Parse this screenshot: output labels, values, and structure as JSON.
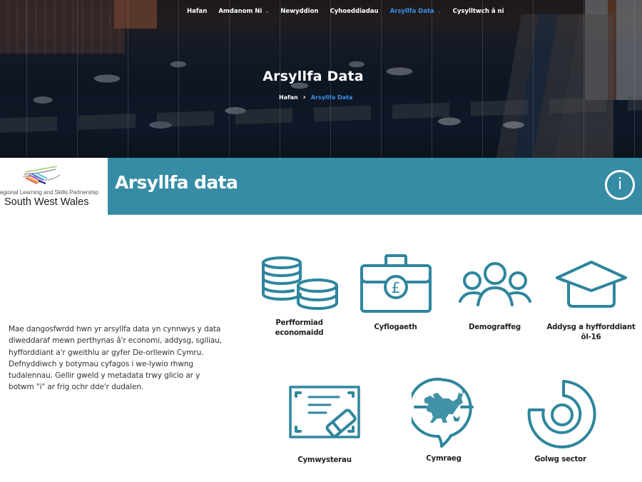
{
  "nav": {
    "items": [
      {
        "label": "Hafan",
        "dropdown": false,
        "active": false
      },
      {
        "label": "Amdanom Ni",
        "dropdown": true,
        "active": false
      },
      {
        "label": "Newyddion",
        "dropdown": false,
        "active": false
      },
      {
        "label": "Cyhoeddiadau",
        "dropdown": false,
        "active": false
      },
      {
        "label": "Arsyllfa Data",
        "dropdown": true,
        "active": true
      },
      {
        "label": "Cysylltwch â ni",
        "dropdown": false,
        "active": false
      }
    ],
    "chevron": "⌄"
  },
  "hero": {
    "title": "Arsyllfa Data",
    "breadcrumb": {
      "home": "Hafan",
      "separator": "›",
      "current": "Arsyllfa Data"
    }
  },
  "banner": {
    "logo_subtitle": "Regional Learning and Skills Partnership",
    "logo_title": "South West Wales",
    "title": "Arsyllfa data",
    "info_label": "i"
  },
  "description": "Mae dangosfwrdd hwn yr arsyllfa data yn cynnwys y data diweddaraf mewn perthynas â'r economi, addysg, sgiliau, hyfforddiant a'r gweithlu ar gyfer De-orllewin Cymru. Defnyddiwch y botymau cyfagos i we-lywio rhwng tudalennau. Gellir gweld y metadata trwy glicio ar y botwm \"i\" ar frig ochr dde'r dudalen.",
  "tiles": [
    {
      "label": "Perfformiad economaidd",
      "icon": "coins-icon"
    },
    {
      "label": "Cyflogaeth",
      "icon": "briefcase-pound-icon"
    },
    {
      "label": "Demograffeg",
      "icon": "people-icon"
    },
    {
      "label": "Addysg a hyfforddiant ôl-16",
      "icon": "graduation-cap-icon"
    },
    {
      "label": "Cymwysterau",
      "icon": "certificate-icon"
    },
    {
      "label": "Cymraeg",
      "icon": "welsh-dragon-speech-icon"
    },
    {
      "label": "Golwg sector",
      "icon": "sector-chart-icon"
    }
  ],
  "colors": {
    "accent": "#368ca4",
    "icon": "#2e869d",
    "nav_active": "#3b8ee6"
  }
}
